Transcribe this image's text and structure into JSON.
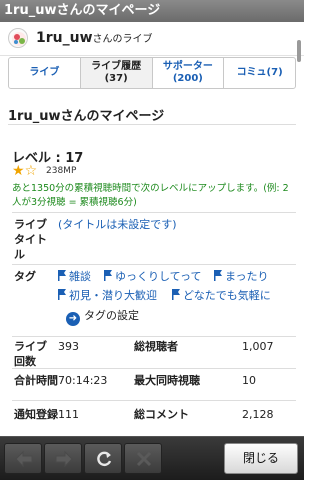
{
  "window": {
    "title": "1ru_uwさんのマイページ"
  },
  "header": {
    "name": "1ru_uw",
    "suffix": "さんのライブ"
  },
  "tabs": [
    {
      "label": "ライブ",
      "count": ""
    },
    {
      "label": "ライブ履歴",
      "count": "(37)"
    },
    {
      "label": "サポーター",
      "count": "(200)"
    },
    {
      "label": "コミュ(7)",
      "count": ""
    }
  ],
  "page": {
    "title": "1ru_uwさんのマイページ"
  },
  "level": {
    "text": "レベル : 17",
    "mp": "238MP",
    "note": "あと1350分の累積視聴時間で次のレベルにアップします。(例: 2人が3分視聴 = 累積視聴6分)"
  },
  "live_title": {
    "label": "ライブタイトル",
    "value": "(タイトルは未設定です)"
  },
  "tags": {
    "label": "タグ",
    "items": [
      "雑談",
      "ゆっくりしてって",
      "まったり",
      "初見・潜り大歓迎",
      "どなたでも気軽に"
    ],
    "settings": "タグの設定"
  },
  "stats": [
    {
      "label": "ライブ回数",
      "value": "393",
      "label2": "総視聴者",
      "value2": "1,007"
    },
    {
      "label": "合計時間",
      "value": "70:14:23",
      "label2": "最大同時視聴",
      "value2": "10"
    },
    {
      "label": "通知登録",
      "value": "111",
      "label2": "総コメント",
      "value2": "2,128"
    }
  ],
  "toolbar": {
    "close": "閉じる"
  },
  "colors": {
    "link": "#1a5fb4",
    "note": "#1d8a1d",
    "star": "#f0a400"
  }
}
